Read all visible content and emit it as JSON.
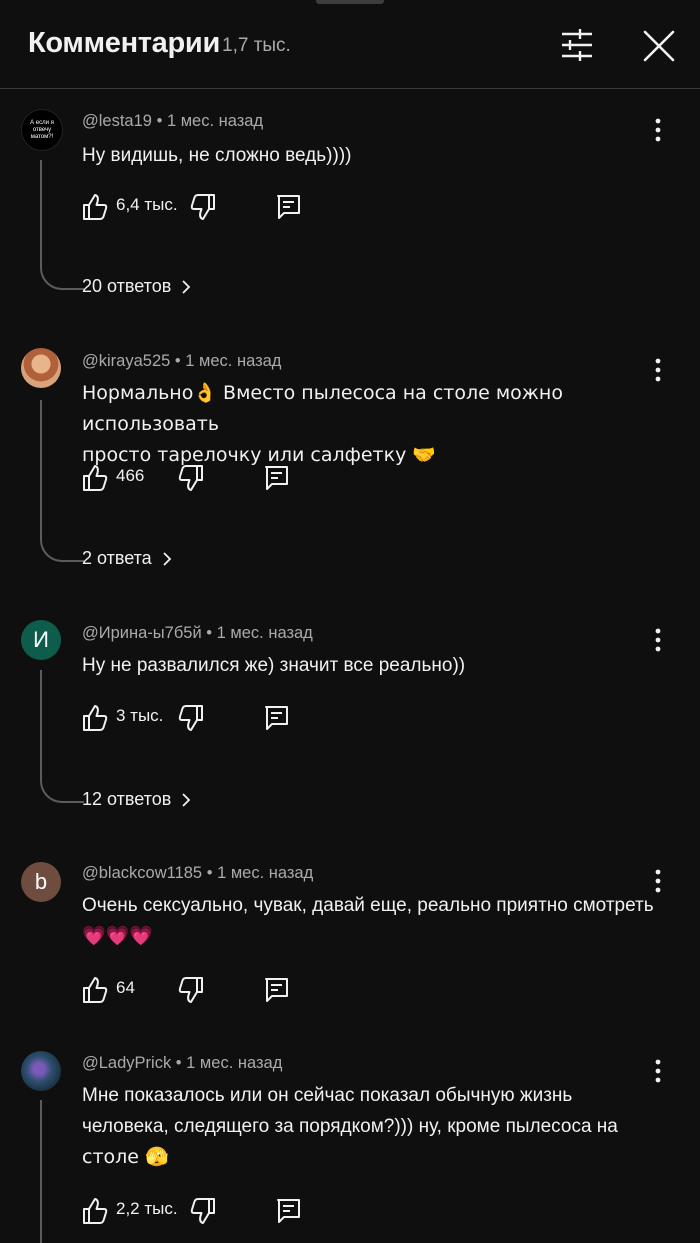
{
  "header": {
    "title": "Комментарии",
    "count": "1,7 тыс."
  },
  "colors": {
    "background": "#0f0f0f",
    "text": "#f1f1f1",
    "secondary_text": "#aaaaaa",
    "thread_line": "#5c5c5c"
  },
  "comments": [
    {
      "author": "@lesta19",
      "time": "1 мес. назад",
      "text": "Ну видишь, не сложно ведь))))",
      "likes": "6,4 тыс.",
      "replies": "20 ответов",
      "avatar_text": "А если я отвечу матом?!"
    },
    {
      "author": "@kiraya525",
      "time": "1 мес. назад",
      "text_line1": "Нормально👌 Вместо пылесоса на столе можно использовать",
      "text_line2": "просто тарелочку или салфетку 🤝",
      "likes": "466",
      "replies": "2 ответа"
    },
    {
      "author": "@Ирина-ы7б5й",
      "time": "1 мес. назад",
      "text": "Ну не развалился же) значит все реально))",
      "likes": "3 тыс.",
      "replies": "12 ответов",
      "avatar_text": "И",
      "avatar_color": "#0d5c4c"
    },
    {
      "author": "@blackcow1185",
      "time": "1 мес. назад",
      "text_line1": "Очень сексуально, чувак, давай еще, реально приятно смотреть",
      "text_line2": "💗💗💗",
      "likes": "64",
      "avatar_text": "b",
      "avatar_color": "#6e4c3e"
    },
    {
      "author": "@LadyPrick",
      "time": "1 мес. назад",
      "text_line1": "Мне показалось или он сейчас показал обычную жизнь",
      "text_line2": "человека, следящего за порядком?))) ну, кроме пылесоса на",
      "text_line3": "столе 🫣",
      "likes": "2,2 тыс."
    }
  ]
}
